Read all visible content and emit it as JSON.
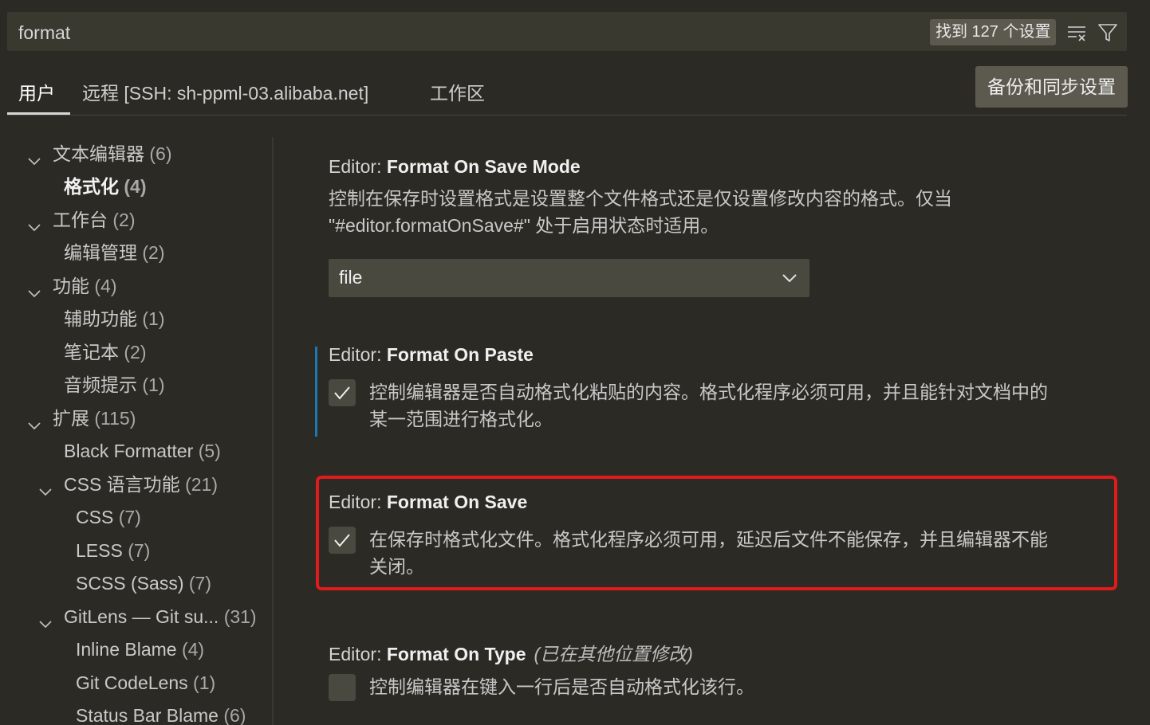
{
  "search": {
    "value": "format",
    "result_count": "找到 127 个设置",
    "clear_filter_icon": "clear-filter-icon",
    "filter_icon": "filter-icon"
  },
  "tabs": [
    {
      "label": "用户",
      "active": true
    },
    {
      "label": "远程 [SSH: sh-ppml-03.alibaba.net]",
      "active": false
    },
    {
      "label": "工作区",
      "active": false
    }
  ],
  "sync_button": "备份和同步设置",
  "toc": [
    {
      "label": "文本编辑器",
      "count": "(6)",
      "expanded": true
    },
    {
      "label": "格式化",
      "count": "(4)",
      "selected": true
    },
    {
      "label": "工作台",
      "count": "(2)",
      "expanded": true
    },
    {
      "label": "编辑管理",
      "count": "(2)"
    },
    {
      "label": "功能",
      "count": "(4)",
      "expanded": true
    },
    {
      "label": "辅助功能",
      "count": "(1)"
    },
    {
      "label": "笔记本",
      "count": "(2)"
    },
    {
      "label": "音频提示",
      "count": "(1)"
    },
    {
      "label": "扩展",
      "count": "(115)",
      "expanded": true
    },
    {
      "label": "Black Formatter",
      "count": "(5)"
    },
    {
      "label": "CSS 语言功能",
      "count": "(21)",
      "expanded": true
    },
    {
      "label": "CSS",
      "count": "(7)"
    },
    {
      "label": "LESS",
      "count": "(7)"
    },
    {
      "label": "SCSS (Sass)",
      "count": "(7)"
    },
    {
      "label": "GitLens — Git su...",
      "count": "(31)",
      "expanded": true
    },
    {
      "label": "Inline Blame",
      "count": "(4)"
    },
    {
      "label": "Git CodeLens",
      "count": "(1)"
    },
    {
      "label": "Status Bar Blame",
      "count": "(6)"
    }
  ],
  "settings": {
    "save_mode": {
      "category": "Editor: ",
      "name": "Format On Save Mode",
      "desc_line1": "控制在保存时设置格式是设置整个文件格式还是仅设置修改内容的格式。仅当",
      "desc_line2": "\"#editor.formatOnSave#\" 处于启用状态时适用。",
      "value": "file"
    },
    "on_paste": {
      "category": "Editor: ",
      "name": "Format On Paste",
      "checked": true,
      "desc_line1": "控制编辑器是否自动格式化粘贴的内容。格式化程序必须可用，并且能针对文档中的",
      "desc_line2": "某一范围进行格式化。"
    },
    "on_save": {
      "category": "Editor: ",
      "name": "Format On Save",
      "checked": true,
      "desc_line1": "在保存时格式化文件。格式化程序必须可用，延迟后文件不能保存，并且编辑器不能",
      "desc_line2": "关闭。"
    },
    "on_type": {
      "category": "Editor: ",
      "name": "Format On Type",
      "modified": "(已在其他位置修改)",
      "checked": false,
      "desc_line1": "控制编辑器在键入一行后是否自动格式化该行。"
    }
  },
  "colors": {
    "highlight": "#e01b1b",
    "focus_bar": "#1f77b4"
  }
}
